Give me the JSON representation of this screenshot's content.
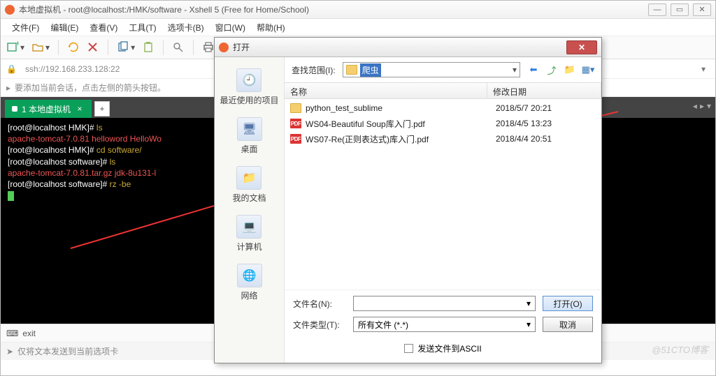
{
  "window": {
    "title": "本地虚拟机 - root@localhost:/HMK/software - Xshell 5 (Free for Home/School)"
  },
  "menu": {
    "file": "文件(F)",
    "edit": "编辑(E)",
    "view": "查看(V)",
    "tools": "工具(T)",
    "tabs": "选项卡(B)",
    "window": "窗口(W)",
    "help": "帮助(H)"
  },
  "address": {
    "value": "ssh://192.168.233.128:22"
  },
  "hint": "要添加当前会话，点击左侧的箭头按钮。",
  "tab": {
    "label": "1 本地虚拟机"
  },
  "terminal": {
    "l1a": "[root@localhost HMK]# ",
    "l1b": "ls",
    "l2": "apache-tomcat-7.0.81  helloword  HelloWo",
    "l3a": "[root@localhost HMK]# ",
    "l3b": "cd software/",
    "l4a": "[root@localhost software]# ",
    "l4b": "ls",
    "l5": "apache-tomcat-7.0.81.tar.gz  jdk-8u131-l",
    "l6a": "[root@localhost software]# ",
    "l6b": "rz -be"
  },
  "status": {
    "exit": "exit",
    "msg": "仅将文本发送到当前选项卡"
  },
  "dialog": {
    "title": "打开",
    "scope_label": "查找范围(I):",
    "scope_value": "爬虫",
    "side": {
      "recent": "最近使用的项目",
      "desktop": "桌面",
      "documents": "我的文档",
      "computer": "计算机",
      "network": "网络"
    },
    "columns": {
      "name": "名称",
      "date": "修改日期"
    },
    "files": [
      {
        "type": "folder",
        "name": "python_test_sublime",
        "date": "2018/5/7 20:21"
      },
      {
        "type": "pdf",
        "name": "WS04-Beautiful Soup库入门.pdf",
        "date": "2018/4/5 13:23"
      },
      {
        "type": "pdf",
        "name": "WS07-Re(正则表达式)库入门.pdf",
        "date": "2018/4/4 20:51"
      }
    ],
    "filename_label": "文件名(N):",
    "filetype_label": "文件类型(T):",
    "filetype_value": "所有文件 (*.*)",
    "open_btn": "打开(O)",
    "cancel_btn": "取消",
    "ascii_label": "发送文件到ASCII"
  },
  "watermark": "@51CTO博客"
}
